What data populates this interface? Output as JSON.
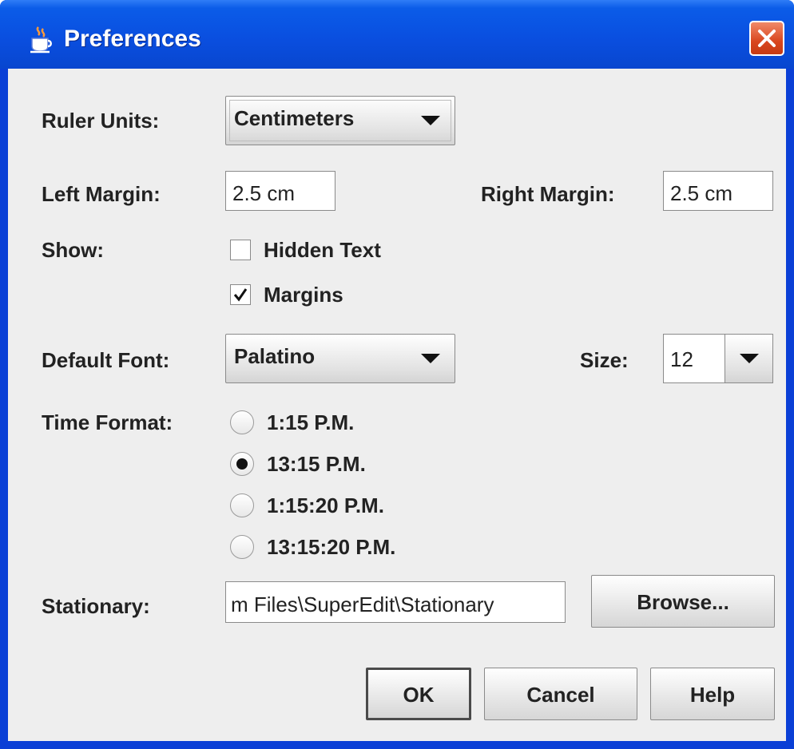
{
  "window": {
    "title": "Preferences"
  },
  "ruler_units": {
    "label": "Ruler Units:",
    "selected": "Centimeters"
  },
  "left_margin": {
    "label": "Left Margin:",
    "value": "2.5 cm"
  },
  "right_margin": {
    "label": "Right Margin:",
    "value": "2.5 cm"
  },
  "show": {
    "label": "Show:",
    "options": [
      {
        "label": "Hidden Text",
        "checked": false
      },
      {
        "label": "Margins",
        "checked": true
      }
    ]
  },
  "default_font": {
    "label": "Default Font:",
    "selected": "Palatino"
  },
  "size": {
    "label": "Size:",
    "value": "12"
  },
  "time_format": {
    "label": "Time Format:",
    "options": [
      {
        "label": "1:15 P.M.",
        "selected": false
      },
      {
        "label": "13:15 P.M.",
        "selected": true
      },
      {
        "label": "1:15:20 P.M.",
        "selected": false
      },
      {
        "label": "13:15:20 P.M.",
        "selected": false
      }
    ]
  },
  "stationary": {
    "label": "Stationary:",
    "value": "m Files\\SuperEdit\\Stationary",
    "browse_label": "Browse..."
  },
  "buttons": {
    "ok": "OK",
    "cancel": "Cancel",
    "help": "Help"
  },
  "icons": {
    "title": "java-cup-icon",
    "close": "close-icon",
    "checkmark": "checkmark-icon"
  }
}
